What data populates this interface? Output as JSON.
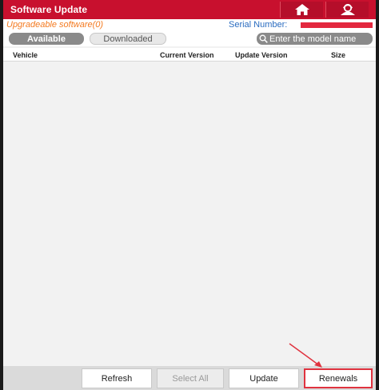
{
  "titlebar": {
    "title": "Software Update",
    "home_icon": "home-icon",
    "user_icon": "user-icon"
  },
  "info": {
    "upgradeable_label": "Upgradeable software(0)",
    "serial_label": "Serial Number:"
  },
  "tabs": [
    {
      "label": "Available",
      "active": true
    },
    {
      "label": "Downloaded",
      "active": false
    }
  ],
  "search": {
    "placeholder": "Enter the model name",
    "icon": "search-icon"
  },
  "table": {
    "columns": [
      "Vehicle",
      "Current Version",
      "Update Version",
      "Size"
    ],
    "rows": []
  },
  "bottom_buttons": {
    "refresh": "Refresh",
    "select_all": "Select All",
    "update": "Update",
    "renewals": "Renewals"
  },
  "colors": {
    "brand_red": "#c8102e",
    "upgradeable_orange": "#f47a20",
    "serial_blue": "#2a6cc0",
    "highlight_red": "#e0333f"
  }
}
